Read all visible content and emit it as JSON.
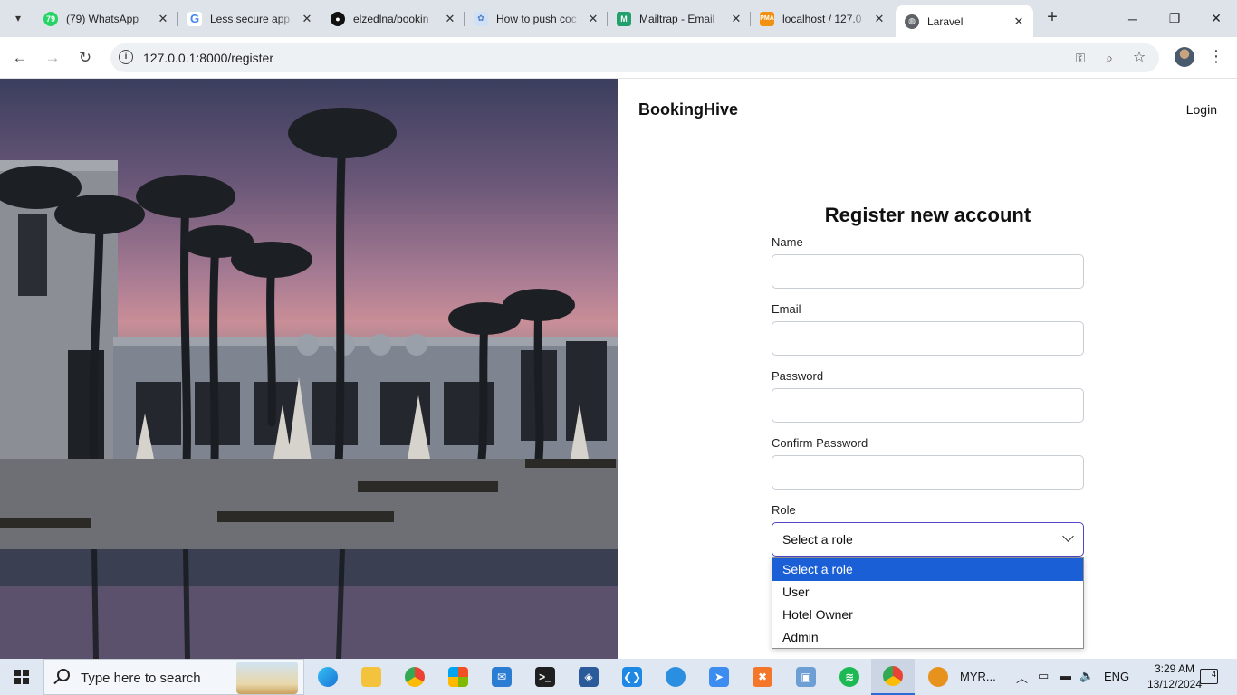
{
  "browser": {
    "tabs": [
      {
        "title": "(79) WhatsApp",
        "badge": "79",
        "favicon": "whatsapp-icon",
        "color": "#25d366"
      },
      {
        "title": "Less secure app",
        "favicon": "google-icon",
        "color": "#4285f4"
      },
      {
        "title": "elzedlna/bookin",
        "favicon": "github-icon",
        "color": "#111111"
      },
      {
        "title": "How to push coc",
        "favicon": "web-icon",
        "color": "#8ab4f8"
      },
      {
        "title": "Mailtrap - Email",
        "favicon": "mailtrap-icon",
        "color": "#22a06b"
      },
      {
        "title": "localhost / 127.0",
        "favicon": "phpmyadmin-icon",
        "color": "#f29111"
      },
      {
        "title": "Laravel",
        "favicon": "globe-icon",
        "color": "#555555"
      }
    ],
    "address": "127.0.0.1:8000/register"
  },
  "page": {
    "brand": "BookingHive",
    "login": "Login",
    "title": "Register new account",
    "fields": {
      "name_label": "Name",
      "email_label": "Email",
      "password_label": "Password",
      "confirm_label": "Confirm Password",
      "role_label": "Role"
    },
    "role": {
      "selected": "Select a role",
      "options": [
        "Select a role",
        "User",
        "Hotel Owner",
        "Admin"
      ]
    },
    "accent": "#4f46c8",
    "highlight": "#1a5fd6"
  },
  "taskbar": {
    "search_placeholder": "Type here to search",
    "weather": "MYR...",
    "language": "ENG",
    "time": "3:29 AM",
    "date": "13/12/2024",
    "notifications": "4"
  }
}
